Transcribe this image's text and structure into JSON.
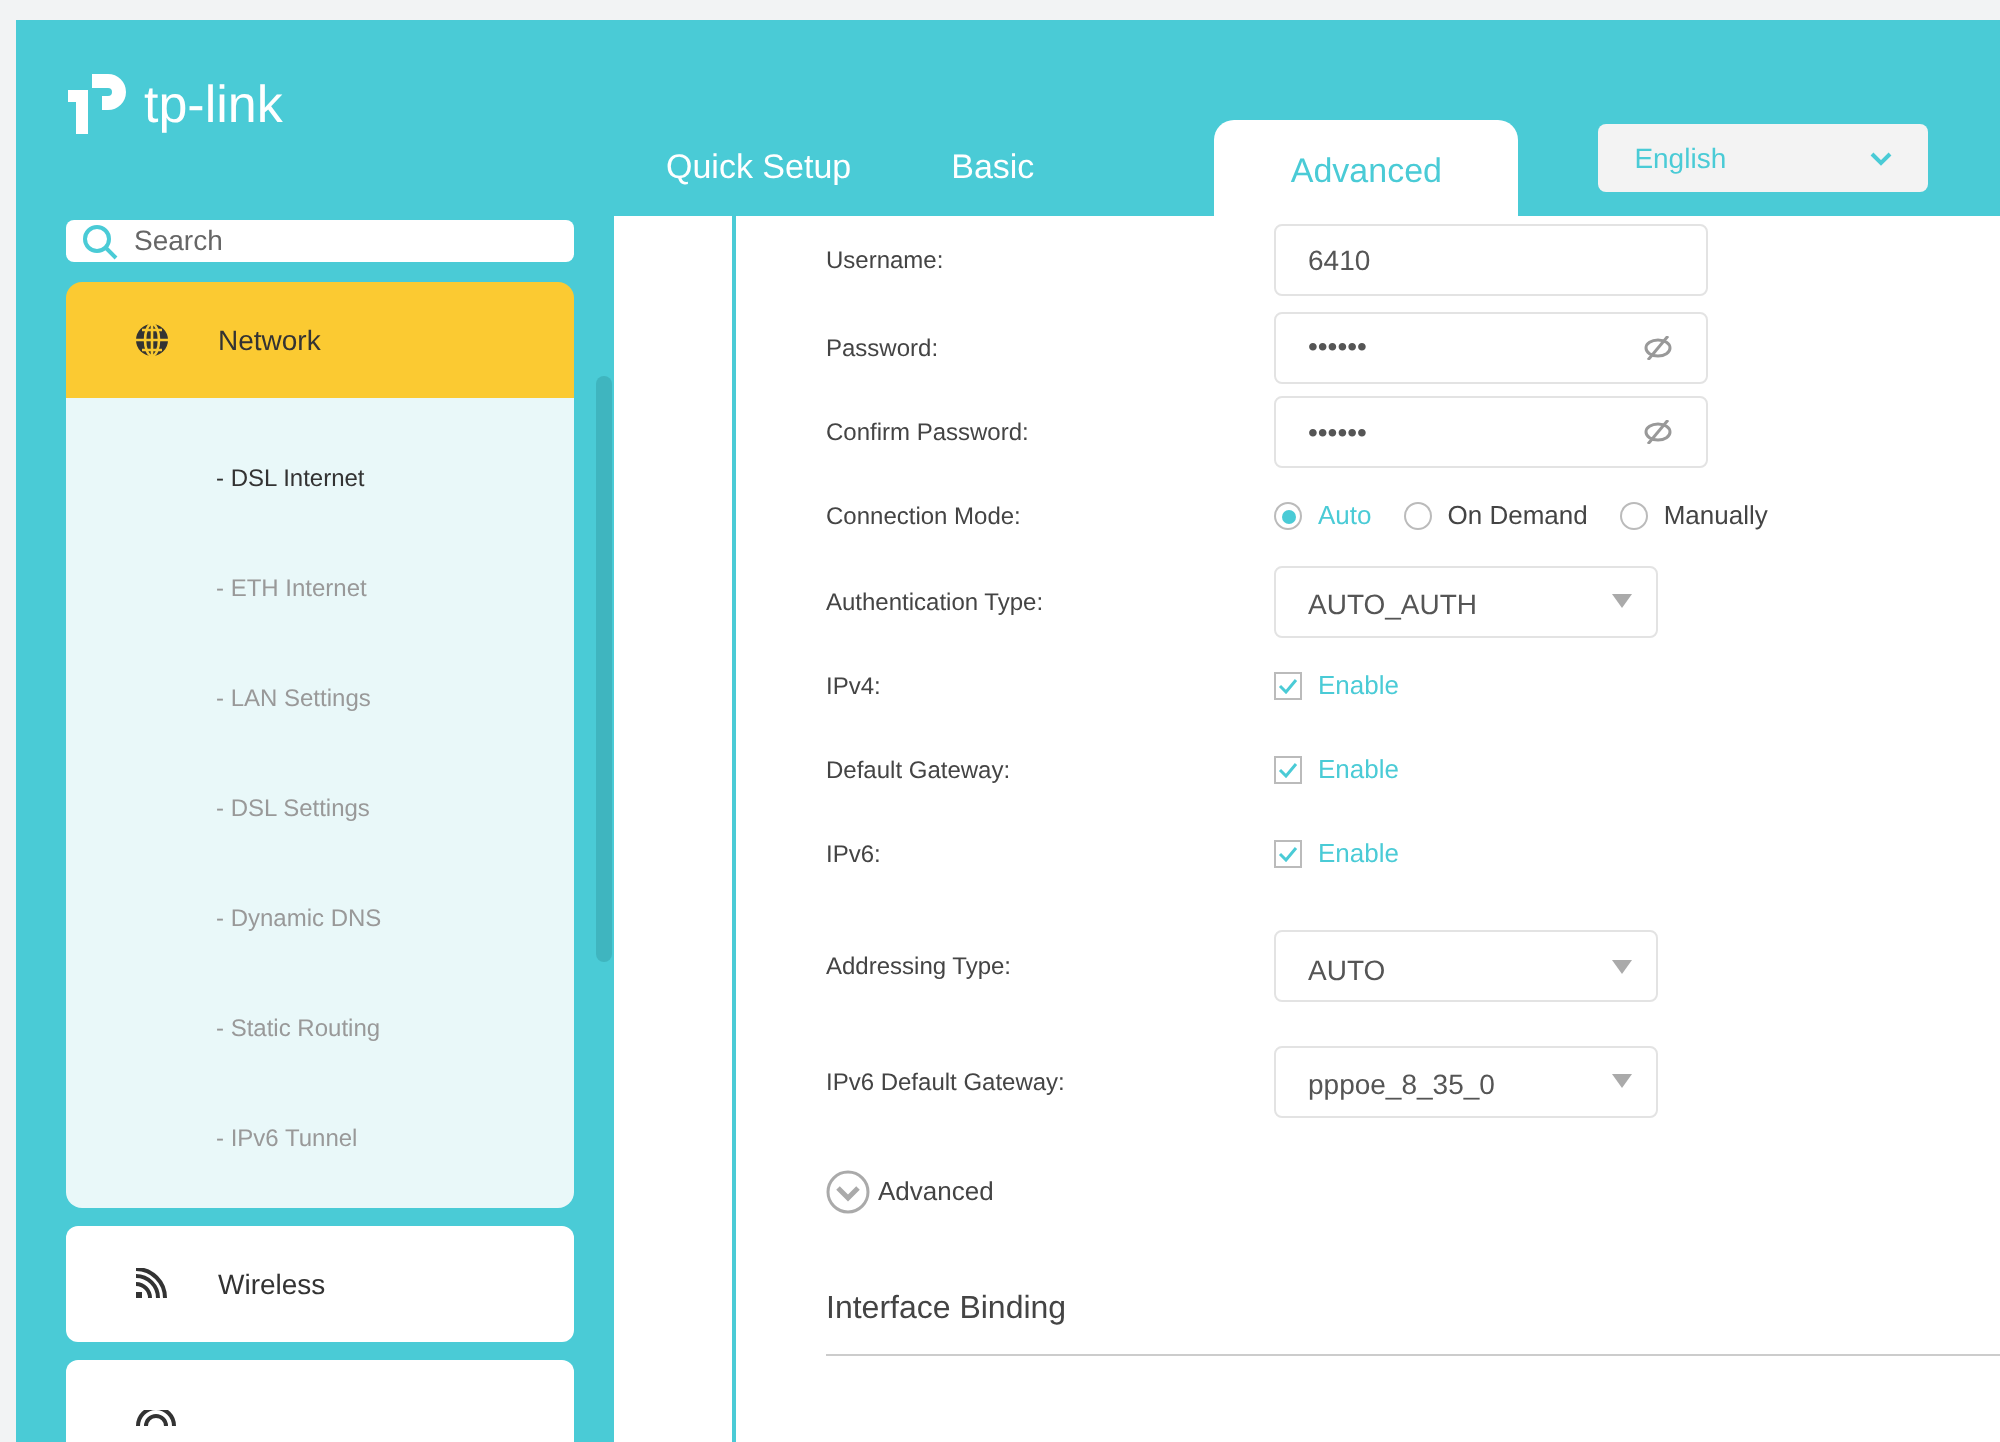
{
  "logo": {
    "text": "tp-link"
  },
  "tabs": [
    {
      "label": "Quick Setup",
      "selected": false
    },
    {
      "label": "Basic",
      "selected": false
    },
    {
      "label": "Advanced",
      "selected": true
    }
  ],
  "language": {
    "value": "English"
  },
  "search": {
    "placeholder": "Search"
  },
  "sidebar": {
    "items": [
      {
        "label": "Network",
        "expanded": true,
        "children": [
          {
            "label": "- DSL Internet",
            "selected": true
          },
          {
            "label": "- ETH Internet",
            "selected": false
          },
          {
            "label": "- LAN Settings",
            "selected": false
          },
          {
            "label": "- DSL Settings",
            "selected": false
          },
          {
            "label": "- Dynamic DNS",
            "selected": false
          },
          {
            "label": "- Static Routing",
            "selected": false
          },
          {
            "label": "- IPv6 Tunnel",
            "selected": false
          }
        ]
      },
      {
        "label": "Wireless",
        "expanded": false
      },
      {
        "expanded": false
      }
    ]
  },
  "form": {
    "rows": [
      {
        "kind": "text",
        "label": "Username:",
        "value": "6410"
      },
      {
        "kind": "password",
        "label": "Password:",
        "value": "••••••"
      },
      {
        "kind": "password",
        "label": "Confirm Password:",
        "value": "••••••"
      },
      {
        "kind": "radio",
        "label": "Connection Mode:",
        "options": [
          {
            "label": "Auto",
            "selected": true
          },
          {
            "label": "On Demand",
            "selected": false
          },
          {
            "label": "Manually",
            "selected": false
          }
        ]
      },
      {
        "kind": "select",
        "label": "Authentication Type:",
        "value": "AUTO_AUTH"
      },
      {
        "kind": "checkbox",
        "label": "IPv4:",
        "option": "Enable",
        "checked": true
      },
      {
        "kind": "checkbox",
        "label": "Default Gateway:",
        "option": "Enable",
        "checked": true
      },
      {
        "kind": "checkbox",
        "label": "IPv6:",
        "option": "Enable",
        "checked": true
      },
      {
        "kind": "select",
        "label": "Addressing Type:",
        "value": "AUTO"
      },
      {
        "kind": "select",
        "label": "IPv6 Default Gateway:",
        "value": "pppoe_8_35_0"
      }
    ],
    "advanced_toggle": {
      "label": "Advanced",
      "expanded": false
    },
    "section_title": "Interface Binding"
  }
}
